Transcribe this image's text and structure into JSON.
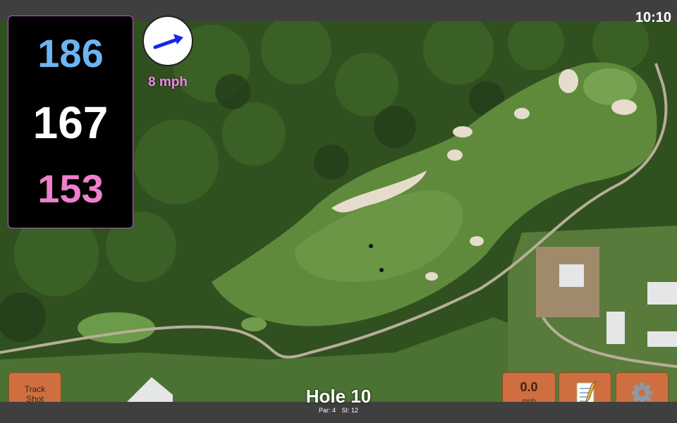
{
  "status": {
    "time": "10:10"
  },
  "distances": {
    "back": "186",
    "middle": "167",
    "front": "153"
  },
  "wind": {
    "speed": "8 mph",
    "direction_icon": "wind-arrow-icon"
  },
  "buttons": {
    "track_shot_line1": "Track",
    "track_shot_line2": "Shot",
    "speed_value": "0.0",
    "speed_unit": "mph",
    "notes_icon": "notepad-icon",
    "settings_icon": "gear-icon"
  },
  "hole": {
    "title": "Hole 10",
    "par": "Par: 4",
    "si": "SI: 12"
  },
  "colors": {
    "back": "#6db4f2",
    "middle": "#ffffff",
    "front": "#f07fcb",
    "wind_speed": "#f389ea",
    "button": "#cf6f3f",
    "panel_border": "#b45dbd"
  }
}
